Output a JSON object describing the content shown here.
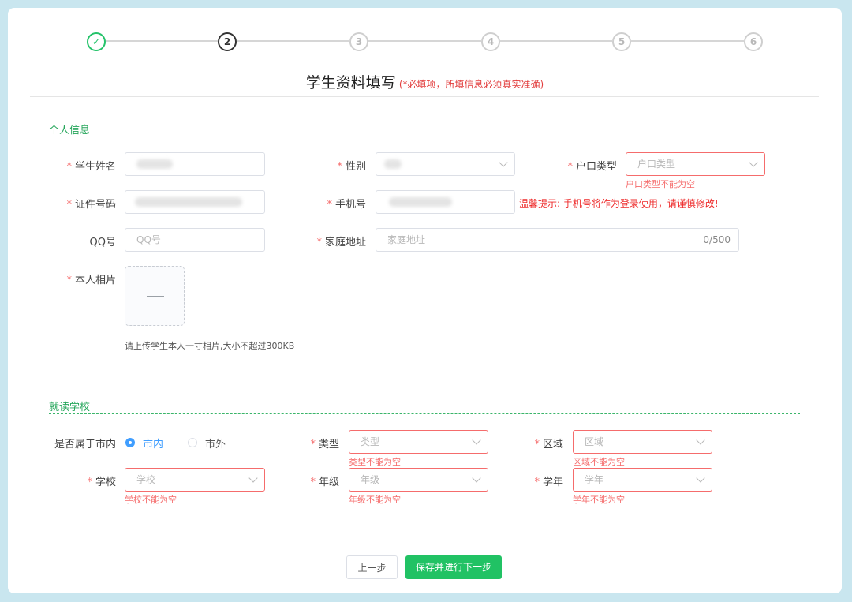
{
  "steps": {
    "step1": "✓",
    "step2": "2",
    "step3": "3",
    "step4": "4",
    "step5": "5",
    "step6": "6"
  },
  "page": {
    "title": "学生资料填写",
    "note": "(*必填项，所填信息必须真实准确)"
  },
  "personal": {
    "section_title": "个人信息",
    "name_label": "学生姓名",
    "gender_label": "性别",
    "hukou_label": "户口类型",
    "hukou_placeholder": "户口类型",
    "hukou_error": "户口类型不能为空",
    "id_label": "证件号码",
    "phone_label": "手机号",
    "phone_warning": "温馨提示: 手机号将作为登录使用，请谨慎修改!",
    "qq_label": "QQ号",
    "qq_placeholder": "QQ号",
    "address_label": "家庭地址",
    "address_placeholder": "家庭地址",
    "address_counter": "0/500",
    "photo_label": "本人相片",
    "photo_hint": "请上传学生本人一寸相片,大小不超过300KB"
  },
  "school": {
    "section_title": "就读学校",
    "in_city_label": "是否属于市内",
    "in_city_option": "市内",
    "out_city_option": "市外",
    "type_label": "类型",
    "type_placeholder": "类型",
    "type_error": "类型不能为空",
    "region_label": "区域",
    "region_placeholder": "区域",
    "region_error": "区域不能为空",
    "school_label": "学校",
    "school_placeholder": "学校",
    "school_error": "学校不能为空",
    "grade_label": "年级",
    "grade_placeholder": "年级",
    "grade_error": "年级不能为空",
    "year_label": "学年",
    "year_placeholder": "学年",
    "year_error": "学年不能为空"
  },
  "actions": {
    "prev": "上一步",
    "next": "保存并进行下一步"
  },
  "required_mark": "*",
  "colors": {
    "accent_green": "#21c264",
    "error_red": "#f56c6c",
    "radio_blue": "#409eff"
  }
}
